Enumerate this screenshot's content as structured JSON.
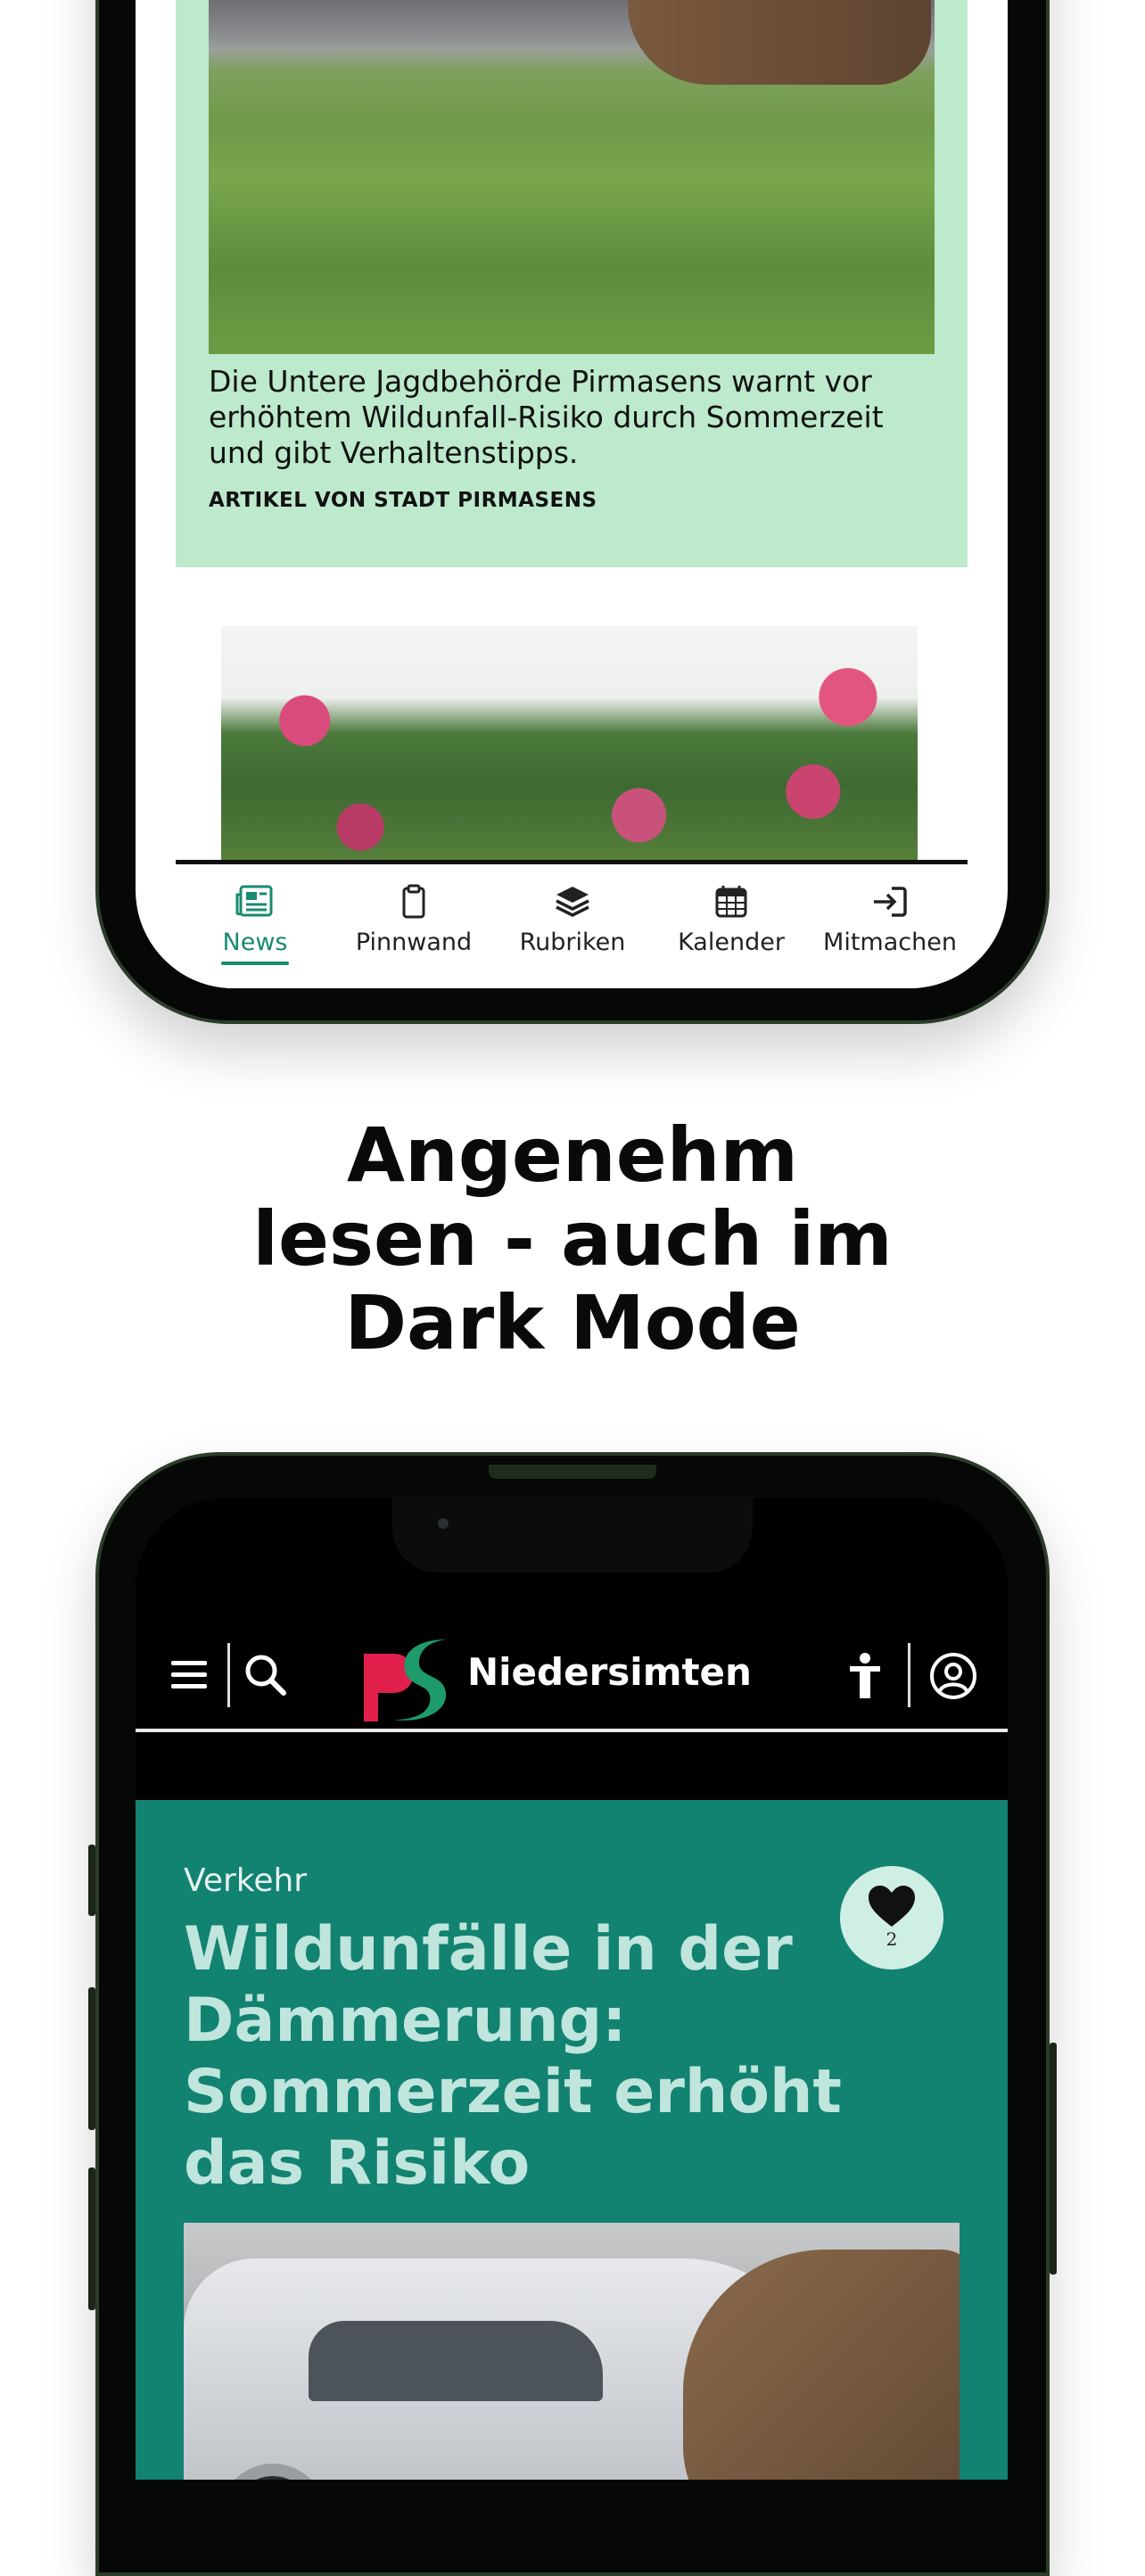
{
  "top_phone": {
    "card": {
      "teaser": "Die Untere Jagdbehörde Pirmasens warnt vor erhöhtem Wildunfall-Risiko durch Sommerzeit und gibt Verhaltenstipps.",
      "source": "ARTIKEL VON STADT PIRMASENS"
    },
    "nav": [
      {
        "label": "News",
        "icon": "newspaper-icon",
        "active": true
      },
      {
        "label": "Pinnwand",
        "icon": "clipboard-icon",
        "active": false
      },
      {
        "label": "Rubriken",
        "icon": "layers-icon",
        "active": false
      },
      {
        "label": "Kalender",
        "icon": "calendar-icon",
        "active": false
      },
      {
        "label": "Mitmachen",
        "icon": "login-icon",
        "active": false
      }
    ],
    "accent_color": "#1a8a72"
  },
  "headline": {
    "line1": "Angenehm",
    "line2": "lesen - auch im",
    "line3": "Dark Mode"
  },
  "bottom_phone": {
    "header": {
      "brand": "Niedersimten",
      "icons": [
        "menu-icon",
        "search-icon",
        "accessibility-icon",
        "account-icon"
      ]
    },
    "article": {
      "category": "Verkehr",
      "title": "Wildunfälle in der Dämmerung: Sommerzeit erhöht das Risiko",
      "likes": "2"
    },
    "colors": {
      "article_bg": "#128271",
      "logo_red": "#e0204a",
      "logo_green": "#1e9b6b"
    }
  }
}
